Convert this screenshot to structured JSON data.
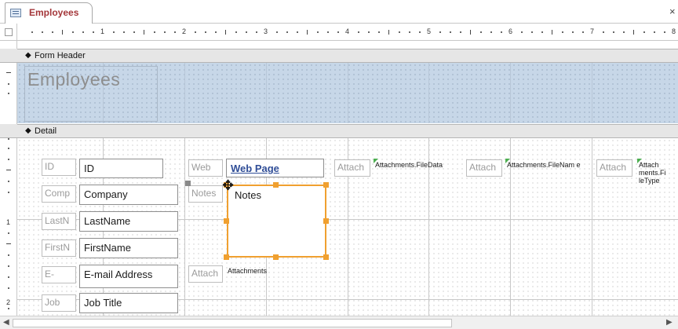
{
  "tab": {
    "label": "Employees",
    "icon": "form-icon",
    "close": "×"
  },
  "ruler": {
    "h_numbers": [
      "1",
      "2",
      "3",
      "4",
      "5",
      "6",
      "7",
      "8"
    ],
    "v_numbers": [
      "1",
      "2"
    ]
  },
  "sections": {
    "form_header": "Form Header",
    "detail": "Detail"
  },
  "header": {
    "title": "Employees"
  },
  "detail": {
    "labels": [
      "ID",
      "Comp",
      "LastN",
      "FirstN",
      "E-",
      "Job"
    ],
    "fields": [
      "ID",
      "Company",
      "LastName",
      "FirstName",
      "E-mail Address",
      "Job Title"
    ],
    "web_label": "Web",
    "web_value": "Web Page",
    "notes_label": "Notes",
    "notes_value": "Notes",
    "attach_label": "Attach",
    "attachments_value": "Attachments",
    "attach_col2_label": "Attach",
    "filedata": "Attachments.FileData",
    "attach_col3_label": "Attach",
    "filename": "Attachments.FileNam e",
    "attach_col4_label": "Attach",
    "filetype": "Attach ments.Fi leType"
  },
  "scroll": {
    "left": "◀",
    "right": "▶"
  },
  "colors": {
    "tab_label": "#a4373a",
    "selection": "#f0a030",
    "header_bg": "#c7d7e8",
    "link": "#2f4d97"
  }
}
